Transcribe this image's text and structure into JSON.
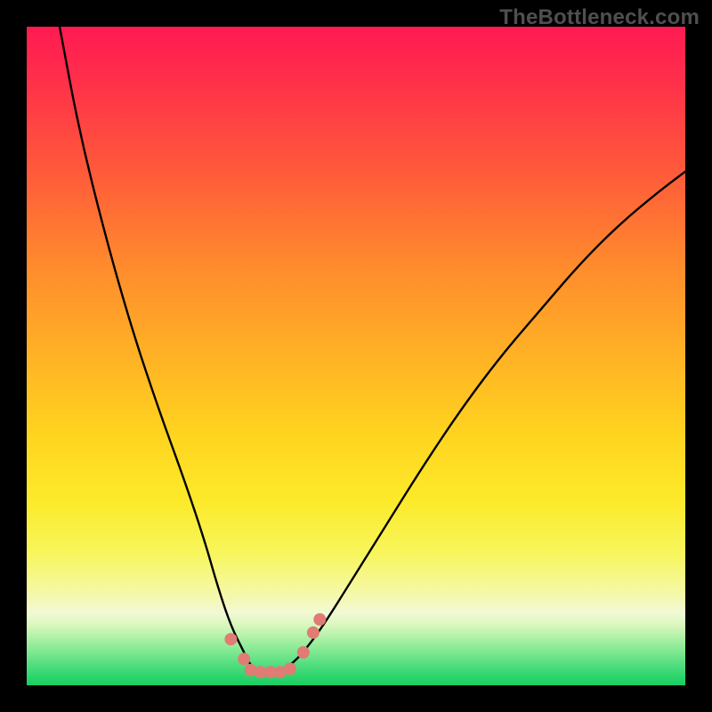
{
  "watermark": "TheBottleneck.com",
  "chart_data": {
    "type": "line",
    "title": "",
    "xlabel": "",
    "ylabel": "",
    "xlim": [
      0,
      100
    ],
    "ylim": [
      0,
      100
    ],
    "grid": false,
    "legend": false,
    "series": [
      {
        "name": "bottleneck-curve",
        "color": "#000000",
        "x": [
          5,
          8,
          12,
          16,
          20,
          24,
          27,
          29,
          31,
          33,
          34,
          35,
          36,
          38,
          40,
          42,
          45,
          50,
          55,
          60,
          66,
          72,
          78,
          84,
          90,
          96,
          100
        ],
        "y": [
          100,
          84,
          68,
          54,
          42,
          31,
          22,
          15,
          9,
          5,
          3,
          2,
          2,
          2,
          3,
          5,
          9,
          17,
          25,
          33,
          42,
          50,
          57,
          64,
          70,
          75,
          78
        ]
      }
    ],
    "markers": {
      "name": "bottom-dots",
      "color": "#e07c74",
      "radius_approx_px": 7,
      "points": [
        {
          "x": 31,
          "y": 7
        },
        {
          "x": 33,
          "y": 4
        },
        {
          "x": 34,
          "y": 2.3
        },
        {
          "x": 35.5,
          "y": 2
        },
        {
          "x": 37,
          "y": 2
        },
        {
          "x": 38.5,
          "y": 2
        },
        {
          "x": 40,
          "y": 2.5
        },
        {
          "x": 42,
          "y": 5
        },
        {
          "x": 43.5,
          "y": 8
        },
        {
          "x": 44.5,
          "y": 10
        }
      ]
    },
    "background_gradient": {
      "direction": "top-to-bottom",
      "stops": [
        {
          "pos": 0.0,
          "color": "#ff1a52"
        },
        {
          "pos": 0.22,
          "color": "#ff5a3a"
        },
        {
          "pos": 0.5,
          "color": "#ffb225"
        },
        {
          "pos": 0.72,
          "color": "#fcea2a"
        },
        {
          "pos": 0.86,
          "color": "#f5f8a8"
        },
        {
          "pos": 0.93,
          "color": "#a9f0a4"
        },
        {
          "pos": 1.0,
          "color": "#18cf61"
        }
      ]
    }
  }
}
